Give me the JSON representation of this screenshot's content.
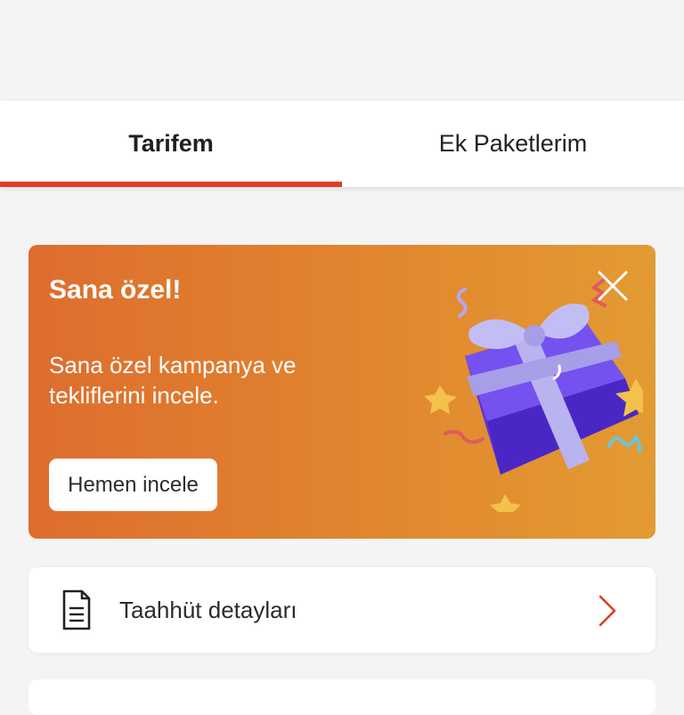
{
  "tabs": [
    {
      "label": "Tarifem",
      "active": true
    },
    {
      "label": "Ek Paketlerim",
      "active": false
    }
  ],
  "promo": {
    "title": "Sana özel!",
    "description": "Sana özel kampanya ve tekliflerini incele.",
    "button_label": "Hemen incele",
    "close_icon": "close-icon",
    "image_icon": "gift-box-illustration"
  },
  "commitment_row": {
    "label": "Taahhüt detayları",
    "icon": "document-icon",
    "chevron_icon": "chevron-right-icon"
  },
  "colors": {
    "accent": "#e03c24",
    "promo_gradient_start": "#de6d2e",
    "promo_gradient_end": "#e39b33"
  }
}
